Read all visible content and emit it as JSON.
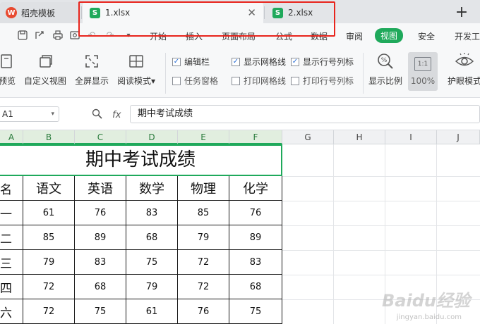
{
  "tabs": {
    "home": "稻壳模板",
    "file1": "1.xlsx",
    "file2": "2.xlsx",
    "close_glyph": "✕",
    "add_glyph": "+"
  },
  "menu": [
    "开始",
    "插入",
    "页面布局",
    "公式",
    "数据",
    "审阅",
    "视图",
    "安全",
    "开发工"
  ],
  "menu_active": "视图",
  "ribbon": {
    "buttons": [
      "预览",
      "自定义视图",
      "全屏显示",
      "阅读模式"
    ],
    "reading_mode_caret": "▾",
    "checks": {
      "edit_bar": "编辑栏",
      "show_grid": "显示网格线",
      "show_headers": "显示行号列标",
      "task_pane": "任务窗格",
      "print_grid": "打印网格线",
      "print_headers": "打印行号列标"
    },
    "check_mark": "✓",
    "zoom_ratio_label": "显示比例",
    "zoom_value": "100%",
    "zoom_icon_text": "1:1",
    "eye_mode": "护眼模式"
  },
  "formula_bar": {
    "cell_ref": "A1",
    "fx": "fx",
    "content": "期中考试成绩"
  },
  "columns": [
    "A",
    "B",
    "C",
    "D",
    "E",
    "F",
    "G",
    "H",
    "I",
    "J"
  ],
  "sheet": {
    "title": "期中考试成绩",
    "headers": [
      "名",
      "语文",
      "英语",
      "数学",
      "物理",
      "化学"
    ],
    "rows": [
      {
        "name": "一",
        "scores": [
          "61",
          "76",
          "83",
          "85",
          "76"
        ]
      },
      {
        "name": "二",
        "scores": [
          "85",
          "89",
          "68",
          "79",
          "89"
        ]
      },
      {
        "name": "三",
        "scores": [
          "79",
          "83",
          "75",
          "72",
          "83"
        ]
      },
      {
        "name": "四",
        "scores": [
          "72",
          "68",
          "79",
          "72",
          "68"
        ]
      },
      {
        "name": "六",
        "scores": [
          "72",
          "75",
          "61",
          "76",
          "75"
        ]
      }
    ]
  },
  "colors": {
    "accent": "#1fa95b",
    "highlight": "#e8241c"
  },
  "watermark": {
    "brand": "Baidu经验",
    "url": "jingyan.baidu.com"
  }
}
